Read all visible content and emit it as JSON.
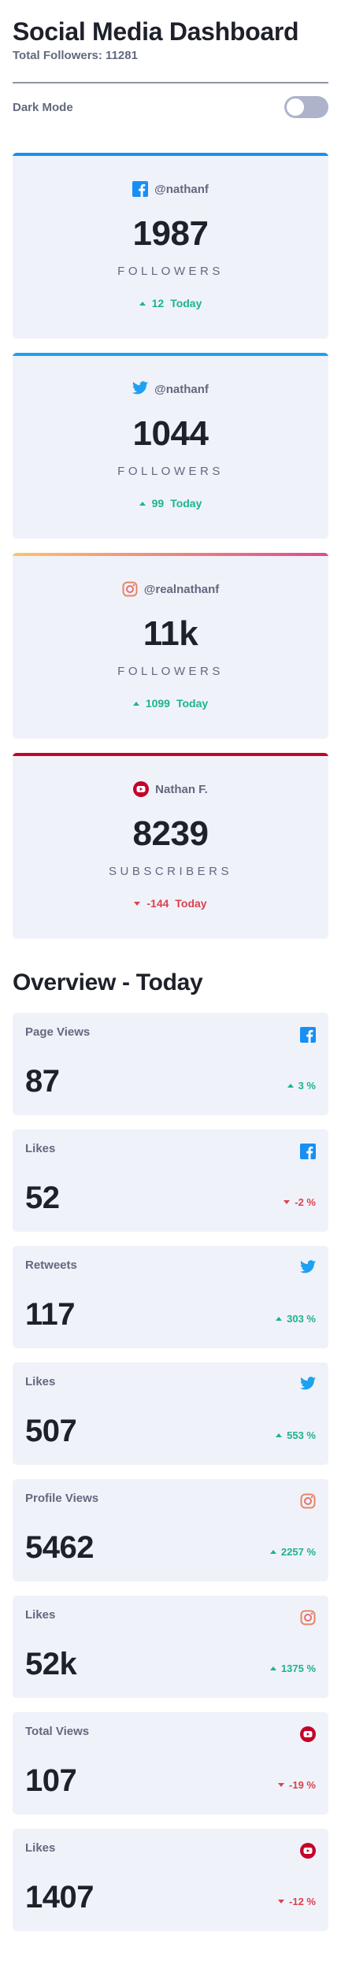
{
  "header": {
    "title": "Social Media Dashboard",
    "total_followers": "Total Followers: 11281"
  },
  "dark_mode": {
    "label": "Dark Mode",
    "enabled": false
  },
  "colors": {
    "facebook": "#178FF5",
    "twitter": "#1DA1F2",
    "instagram_start": "#FDC468",
    "instagram_end": "#DF4996",
    "youtube": "#C4032A",
    "positive": "#1DB489",
    "negative": "#DC414C"
  },
  "cards": [
    {
      "network": "facebook",
      "icon": "facebook-icon",
      "handle": "@nathanf",
      "count": "1987",
      "label": "FOLLOWERS",
      "change": "12",
      "change_suffix": "Today",
      "direction": "up"
    },
    {
      "network": "twitter",
      "icon": "twitter-icon",
      "handle": "@nathanf",
      "count": "1044",
      "label": "FOLLOWERS",
      "change": "99",
      "change_suffix": "Today",
      "direction": "up"
    },
    {
      "network": "instagram",
      "icon": "instagram-icon",
      "handle": "@realnathanf",
      "count": "11k",
      "label": "FOLLOWERS",
      "change": "1099",
      "change_suffix": "Today",
      "direction": "up"
    },
    {
      "network": "youtube",
      "icon": "youtube-icon",
      "handle": "Nathan F.",
      "count": "8239",
      "label": "SUBSCRIBERS",
      "change": "-144",
      "change_suffix": "Today",
      "direction": "down"
    }
  ],
  "overview": {
    "title": "Overview - Today",
    "items": [
      {
        "label": "Page Views",
        "icon": "facebook-icon",
        "network": "facebook",
        "value": "87",
        "change": "3 %",
        "direction": "up"
      },
      {
        "label": "Likes",
        "icon": "facebook-icon",
        "network": "facebook",
        "value": "52",
        "change": "-2 %",
        "direction": "down"
      },
      {
        "label": "Retweets",
        "icon": "twitter-icon",
        "network": "twitter",
        "value": "117",
        "change": "303 %",
        "direction": "up"
      },
      {
        "label": "Likes",
        "icon": "twitter-icon",
        "network": "twitter",
        "value": "507",
        "change": "553 %",
        "direction": "up"
      },
      {
        "label": "Profile Views",
        "icon": "instagram-icon",
        "network": "instagram",
        "value": "5462",
        "change": "2257 %",
        "direction": "up"
      },
      {
        "label": "Likes",
        "icon": "instagram-icon",
        "network": "instagram",
        "value": "52k",
        "change": "1375 %",
        "direction": "up"
      },
      {
        "label": "Total Views",
        "icon": "youtube-icon",
        "network": "youtube",
        "value": "107",
        "change": "-19 %",
        "direction": "down"
      },
      {
        "label": "Likes",
        "icon": "youtube-icon",
        "network": "youtube",
        "value": "1407",
        "change": "-12 %",
        "direction": "down"
      }
    ]
  }
}
